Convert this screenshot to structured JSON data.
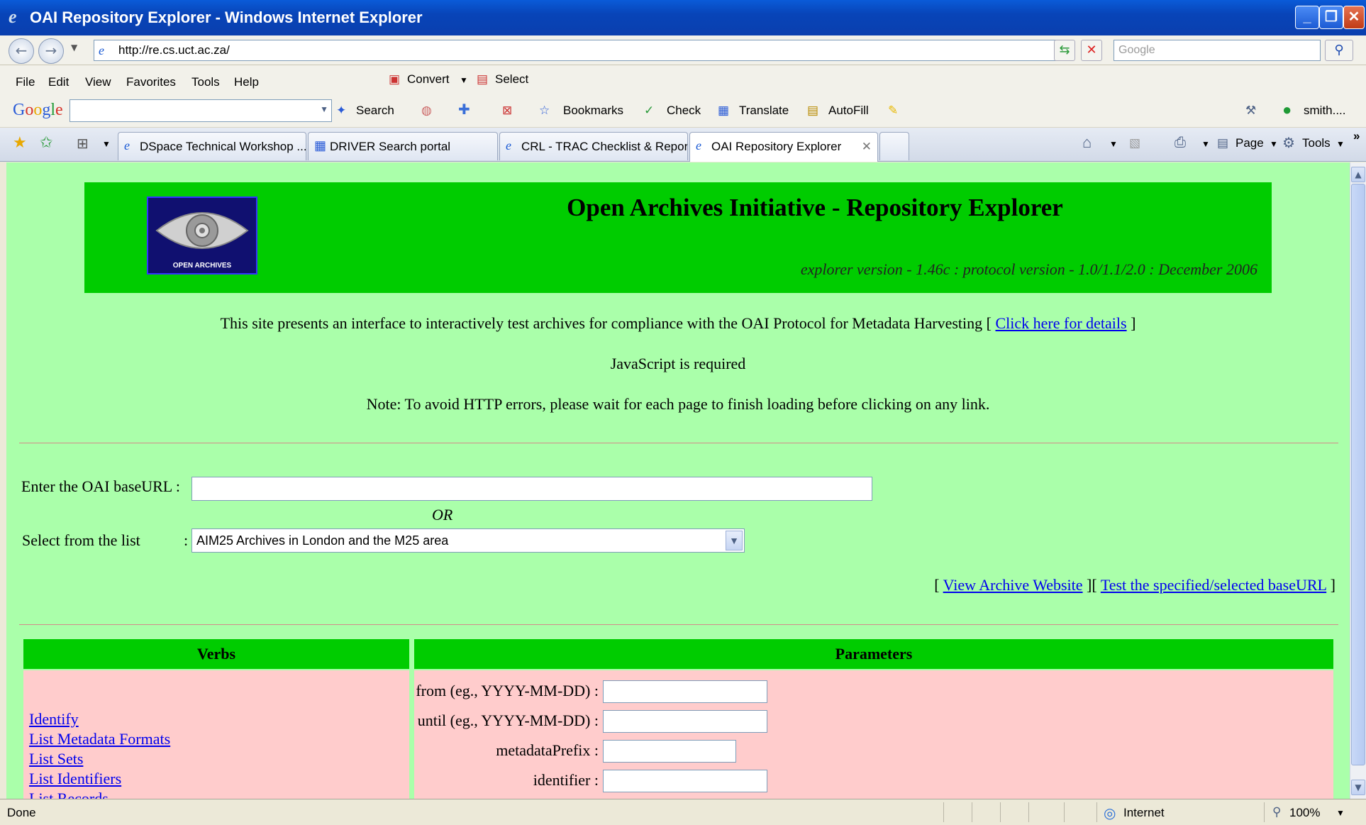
{
  "window": {
    "title": "OAI Repository Explorer - Windows Internet Explorer"
  },
  "address": {
    "url": "http://re.cs.uct.ac.za/",
    "search_placeholder": "Google"
  },
  "menubar": {
    "items": [
      "File",
      "Edit",
      "View",
      "Favorites",
      "Tools",
      "Help"
    ],
    "convert_label": "Convert",
    "select_label": "Select"
  },
  "googlebar": {
    "logo": [
      "G",
      "o",
      "o",
      "g",
      "l",
      "e"
    ],
    "search_label": "Search",
    "bookmarks_label": "Bookmarks",
    "check_label": "Check",
    "translate_label": "Translate",
    "autofill_label": "AutoFill",
    "user_label": "smith...."
  },
  "tabs": [
    {
      "label": "DSpace Technical Workshop ..."
    },
    {
      "label": "DRIVER Search portal"
    },
    {
      "label": "CRL - TRAC Checklist & Report"
    },
    {
      "label": "OAI Repository Explorer"
    }
  ],
  "commandbar": {
    "page_label": "Page",
    "tools_label": "Tools"
  },
  "page": {
    "title": "Open Archives Initiative - Repository Explorer",
    "logo_text": "OPEN ARCHIVES",
    "version": "explorer version - 1.46c : protocol version - 1.0/1.1/2.0 : December 2006",
    "intro_text": "This site presents an interface to interactively test archives for compliance with the OAI Protocol for Metadata Harvesting [",
    "intro_link": "Click here for details",
    "intro_end": "]",
    "js_required": "JavaScript is required",
    "note": "Note: To avoid HTTP errors, please wait for each page to finish loading before clicking on any link.",
    "baseurl_label": "Enter the OAI baseURL :",
    "or_label": "OR",
    "select_label": "Select from the list",
    "select_colon": ":",
    "selected_archive": "AIM25 Archives in London and the M25 area",
    "bracket_open": "[",
    "view_archive_link": "View Archive Website",
    "bracket_mid": "][",
    "test_link": "Test the specified/selected baseURL",
    "bracket_close": "]",
    "verbs_header": "Verbs",
    "params_header": "Parameters",
    "verbs": [
      "Identify",
      "List Metadata Formats",
      "List Sets",
      "List Identifiers",
      "List Records"
    ],
    "params": [
      {
        "label": "from (eg., YYYY-MM-DD) :"
      },
      {
        "label": "until (eg., YYYY-MM-DD) :"
      },
      {
        "label": "metadataPrefix :"
      },
      {
        "label": "identifier :"
      }
    ]
  },
  "statusbar": {
    "status": "Done",
    "zone": "Internet",
    "zoom": "100%"
  }
}
